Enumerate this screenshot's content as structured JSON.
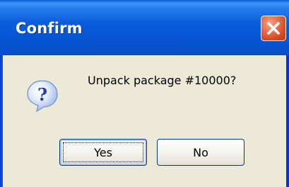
{
  "dialog": {
    "title": "Confirm",
    "message": "Unpack package #10000?",
    "icon": "question-icon",
    "buttons": {
      "yes_label": "Yes",
      "no_label": "No"
    },
    "colors": {
      "titlebar": "#0654d3",
      "client_background": "#ece9d8",
      "close_button": "#d4441f"
    }
  }
}
